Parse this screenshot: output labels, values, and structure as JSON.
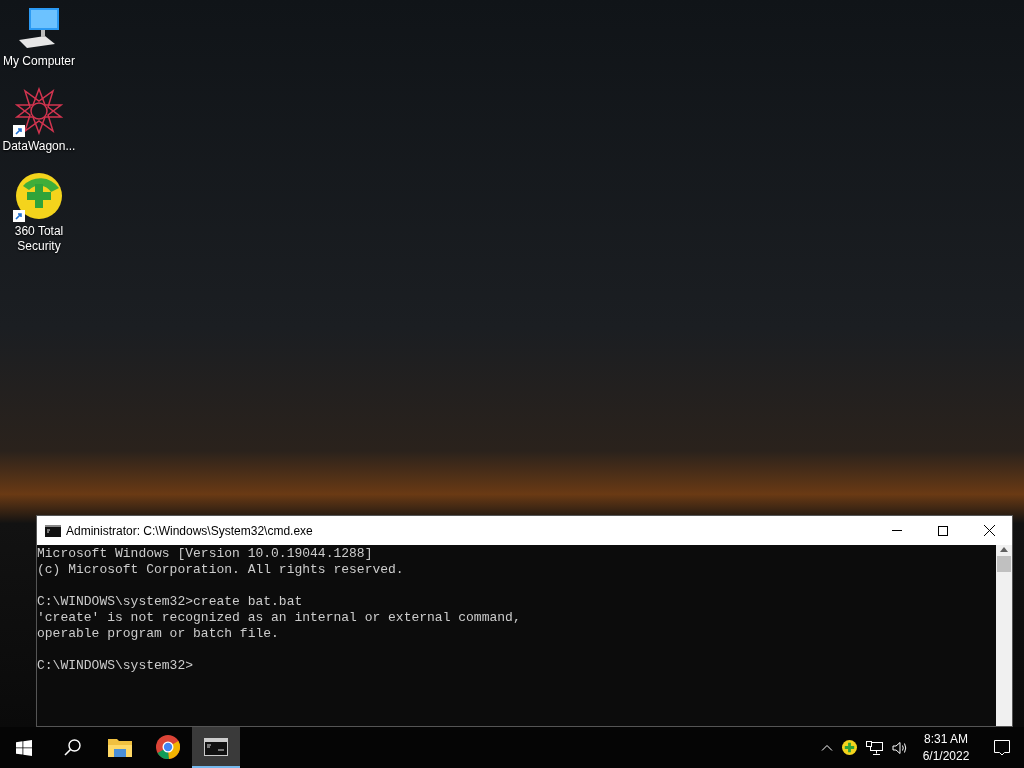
{
  "desktop_icons": [
    {
      "kind": "computer",
      "label": "My Computer",
      "shortcut": false
    },
    {
      "kind": "datawagon",
      "label": "DataWagon...",
      "shortcut": true
    },
    {
      "kind": "security",
      "label": "360 Total Security",
      "shortcut": true
    }
  ],
  "window": {
    "title": "Administrator: C:\\Windows\\System32\\cmd.exe",
    "console_blocks": [
      [
        "Microsoft Windows [Version 10.0.19044.1288]",
        "(c) Microsoft Corporation. All rights reserved."
      ],
      [
        "C:\\WINDOWS\\system32>create bat.bat",
        "'create' is not recognized as an internal or external command,",
        "operable program or batch file."
      ],
      [
        "C:\\WINDOWS\\system32>"
      ]
    ]
  },
  "taskbar": {
    "apps": [
      {
        "kind": "explorer",
        "selected": false
      },
      {
        "kind": "chrome",
        "selected": false
      },
      {
        "kind": "cmd",
        "selected": true
      }
    ],
    "clock": {
      "time": "8:31 AM",
      "date": "6/1/2022"
    }
  }
}
